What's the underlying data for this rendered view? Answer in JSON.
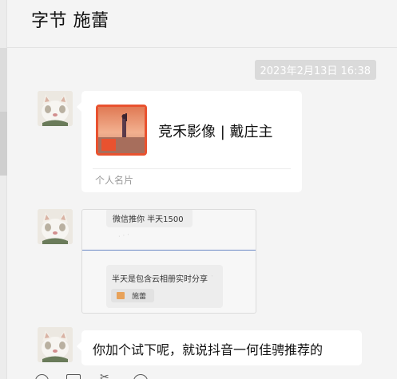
{
  "header": {
    "title": "字节  施蕾"
  },
  "messages": {
    "timestamp": "2023年2月13日 16:38",
    "card": {
      "name": "竞禾影像 | 戴庄主",
      "type": "个人名片"
    },
    "screenshot": {
      "line1": "微信推你 半天1500",
      "line2": "半天是包含云相册实时分享",
      "chip_label": "施蕾"
    },
    "text": {
      "body": "你加个试下呢，就说抖音一何佳骋推荐的"
    }
  },
  "toolbar": {
    "icons": [
      "emoji-icon",
      "folder-icon",
      "scissors-icon",
      "chat-history-icon"
    ]
  },
  "colors": {
    "background": "#f4f4f4",
    "bubble": "#ffffff",
    "timestamp_bg": "#dadada",
    "card_border": "#e9522f"
  }
}
